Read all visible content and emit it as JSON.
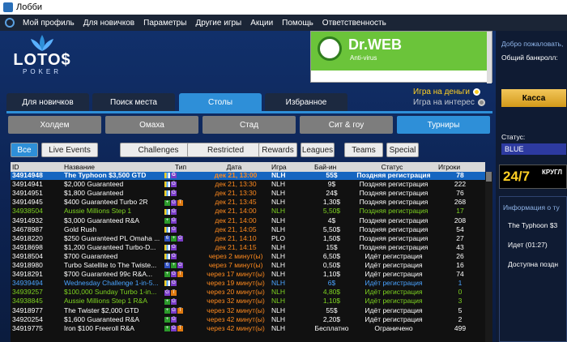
{
  "window": {
    "title": "Лобби"
  },
  "menu": [
    "Мой профиль",
    "Для новичков",
    "Параметры",
    "Другие игры",
    "Акции",
    "Помощь",
    "Ответственность"
  ],
  "brand": {
    "line1": "LOTO$",
    "line2": "POKER"
  },
  "ad": {
    "label": "Dr.WEB",
    "sub": "Anti-virus"
  },
  "mode": {
    "real": "Игра на деньги",
    "play": "Игра на интерес"
  },
  "main_tabs": [
    "Для новичков",
    "Поиск места",
    "Столы",
    "Избранное"
  ],
  "game_tabs": [
    "Холдем",
    "Омаха",
    "Стад",
    "Сит & гоу",
    "Турниры"
  ],
  "filters": [
    "Все",
    "Live Events",
    "Challenges",
    "Restricted",
    "Rewards",
    "Leagues",
    "Teams",
    "Special"
  ],
  "columns": [
    "ID",
    "Название",
    "Тип",
    "Дата",
    "Игра",
    "Бай-ин",
    "Статус",
    "Игроки"
  ],
  "rows": [
    {
      "id": "34914948",
      "name": "The Typhoon $3,500 GTD",
      "icons": "g",
      "date": "дек 21, 13:00",
      "game": "NLH",
      "buyin": "55$",
      "status": "Поздняя регистрация",
      "players": "78"
    },
    {
      "id": "34914941",
      "name": "$2,000 Guaranteed",
      "icons": "g",
      "date": "дек 21, 13:30",
      "game": "NLH",
      "buyin": "9$",
      "status": "Поздняя регистрация",
      "players": "222"
    },
    {
      "id": "34914951",
      "name": "$1,800 Guaranteed",
      "icons": "g",
      "date": "дек 21, 13:30",
      "game": "NLH",
      "buyin": "24$",
      "status": "Поздняя регистрация",
      "players": "76"
    },
    {
      "id": "34914945",
      "name": "$400 Guaranteed Turbo 2R",
      "icons": "+gt",
      "date": "дек 21, 13:45",
      "game": "NLH",
      "buyin": "1,30$",
      "status": "Поздняя регистрация",
      "players": "268"
    },
    {
      "id": "34938504",
      "name": "Aussie Millions Step 1",
      "icons": "g",
      "date": "дек 21, 14:00",
      "game": "NLH",
      "buyin": "5,50$",
      "status": "Поздняя регистрация",
      "players": "17"
    },
    {
      "id": "34914932",
      "name": "$3,000 Guaranteed R&A",
      "icons": "+g",
      "date": "дек 21, 14:00",
      "game": "NLH",
      "buyin": "4$",
      "status": "Поздняя регистрация",
      "players": "208"
    },
    {
      "id": "34678987",
      "name": "Gold Rush",
      "icons": "g",
      "date": "дек 21, 14:05",
      "game": "NLH",
      "buyin": "5,50$",
      "status": "Поздняя регистрация",
      "players": "54"
    },
    {
      "id": "34918220",
      "name": "$250 Guaranteed PL Omaha ...",
      "icons": "6+g",
      "date": "дек 21, 14:10",
      "game": "PLO",
      "buyin": "1,50$",
      "status": "Поздняя регистрация",
      "players": "27"
    },
    {
      "id": "34918698",
      "name": "$1,200 Guaranteed Turbo-D...",
      "icons": "g",
      "date": "дек 21, 14:15",
      "game": "NLH",
      "buyin": "15$",
      "status": "Поздняя регистрация",
      "players": "43"
    },
    {
      "id": "34918504",
      "name": "$700 Guaranteed",
      "icons": "g",
      "date": "через 2 минут(ы)",
      "game": "NLH",
      "buyin": "6,50$",
      "status": "Идёт регистрация",
      "players": "26"
    },
    {
      "id": "34918980",
      "name": "Turbo Satellite to The Twiste...",
      "icons": "6+g",
      "date": "через 7 минут(ы)",
      "game": "NLH",
      "buyin": "0,50$",
      "status": "Идёт регистрация",
      "players": "16"
    },
    {
      "id": "34918291",
      "name": "$700 Guaranteed 99c R&A...",
      "icons": "+gt",
      "date": "через 17 минут(ы)",
      "game": "NLH",
      "buyin": "1,10$",
      "status": "Идёт регистрация",
      "players": "74"
    },
    {
      "id": "34939494",
      "name": "Wednesday Challenge 1-in-5...",
      "icons": "g",
      "date": "через 19 минут(ы)",
      "game": "NLH",
      "buyin": "6$",
      "status": "Идёт регистрация",
      "players": "1"
    },
    {
      "id": "34939257",
      "name": "$100,000 Sunday Turbo 1-in...",
      "icons": "gt",
      "date": "через 20 минут(ы)",
      "game": "NLH",
      "buyin": "4,80$",
      "status": "Идёт регистрация",
      "players": "0"
    },
    {
      "id": "34938845",
      "name": "Aussie Millions Step 1 R&A",
      "icons": "+g",
      "date": "через 32 минут(ы)",
      "game": "NLH",
      "buyin": "1,10$",
      "status": "Идёт регистрация",
      "players": "3"
    },
    {
      "id": "34918977",
      "name": "The Twister $2,000 GTD",
      "icons": "+gt",
      "date": "через 32 минут(ы)",
      "game": "NLH",
      "buyin": "55$",
      "status": "Идёт регистрация",
      "players": "5"
    },
    {
      "id": "34920254",
      "name": "$1,600 Guaranteed R&A",
      "icons": "+g",
      "date": "через 42 минут(ы)",
      "game": "NLH",
      "buyin": "2,20$",
      "status": "Идёт регистрация",
      "players": "2"
    },
    {
      "id": "34919775",
      "name": "Iron $100 Freeroll R&A",
      "icons": "+gt",
      "date": "через 42 минут(ы)",
      "game": "NLH",
      "buyin": "Бесплатно",
      "status": "Ограничено",
      "players": "499"
    }
  ],
  "right": {
    "welcome": "Добро пожаловать,",
    "bankroll": "Общий банкролл:",
    "cash": "Касса",
    "status_label": "Статус:",
    "status_value": "BLUE",
    "banner_num": "24/7",
    "banner_text": "КРУГЛ",
    "info_title": "Информация о ту",
    "info_name": "The Typhoon $3",
    "info_state": "Идет (01:27)",
    "info_avail": "Доступна поздн"
  },
  "colors": {
    "accent": "#2e8fd8",
    "selected_row": "#1565c0",
    "orange": "#ff8a1e",
    "green": "#7ed321",
    "blue_row": "#4aa3ff",
    "yellow": "#ffd024"
  }
}
